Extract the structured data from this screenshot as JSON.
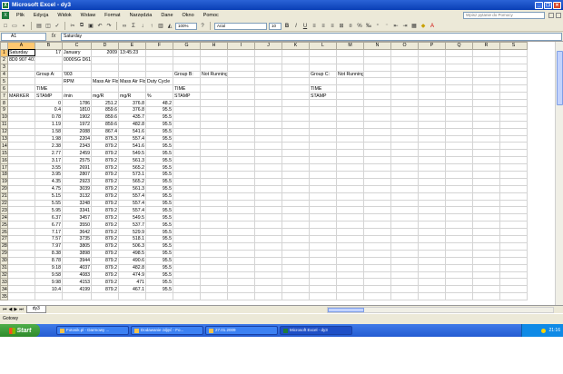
{
  "window": {
    "title": "Microsoft Excel - dy3"
  },
  "menu": {
    "items": [
      "Plik",
      "Edycja",
      "Widok",
      "Wstaw",
      "Format",
      "Narzędzia",
      "Dane",
      "Okno",
      "Pomoc"
    ],
    "help_placeholder": "Wpisz pytanie do Pomocy"
  },
  "toolbar": {
    "zoom": "100%",
    "font": "Arial",
    "size": "10"
  },
  "formula_bar": {
    "name_box": "A1",
    "fx": "fx",
    "value": "Saturday"
  },
  "columns": [
    "A",
    "B",
    "C",
    "D",
    "E",
    "F",
    "G",
    "H",
    "I",
    "J",
    "K",
    "L",
    "M",
    "N",
    "O",
    "P",
    "Q",
    "R",
    "S"
  ],
  "rows": [
    [
      "Saturday",
      "17",
      "January",
      "2009",
      "13:45:23",
      "",
      "",
      "",
      "",
      "",
      "",
      "",
      "",
      "",
      "",
      "",
      "",
      "",
      ""
    ],
    [
      "8D0 907 401 F 2",
      "",
      "0000SG  D61",
      "",
      "",
      "",
      "",
      "",
      "",
      "",
      "",
      "",
      "",
      "",
      "",
      "",
      "",
      "",
      ""
    ],
    [
      "",
      "",
      "",
      "",
      "",
      "",
      "",
      "",
      "",
      "",
      "",
      "",
      "",
      "",
      "",
      "",
      "",
      "",
      ""
    ],
    [
      "",
      "Group A:",
      "'003",
      "",
      "",
      "",
      "Group B:",
      "Not Running",
      "",
      "",
      "",
      "Group C:",
      "Not Running",
      "",
      "",
      "",
      "",
      "",
      ""
    ],
    [
      "",
      "",
      "RPM",
      "Mass Air Flow",
      "Mass Air Flow",
      "Duty Cycle",
      "",
      "",
      "",
      "",
      "",
      "",
      "",
      "",
      "",
      "",
      "",
      "",
      ""
    ],
    [
      "",
      "TIME",
      "",
      "",
      "",
      "",
      "TIME",
      "",
      "",
      "",
      "",
      "TIME",
      "",
      "",
      "",
      "",
      "",
      "",
      ""
    ],
    [
      "MARKER",
      "STAMP",
      "/min",
      "mg/R",
      "mg/R",
      "%",
      "STAMP",
      "",
      "",
      "",
      "",
      "STAMP",
      "",
      "",
      "",
      "",
      "",
      "",
      ""
    ],
    [
      "",
      "0",
      "1786",
      "251.2",
      "376.8",
      "48.2"
    ],
    [
      "",
      "0.4",
      "1810",
      "859.6",
      "376.8",
      "95.5"
    ],
    [
      "",
      "0.78",
      "1902",
      "859.6",
      "435.7",
      "95.5"
    ],
    [
      "",
      "1.19",
      "1972",
      "859.6",
      "482.8",
      "95.5"
    ],
    [
      "",
      "1.58",
      "2088",
      "867.4",
      "541.6",
      "95.5"
    ],
    [
      "",
      "1.98",
      "2204",
      "875.3",
      "557.4",
      "95.5"
    ],
    [
      "",
      "2.38",
      "2343",
      "879.2",
      "541.6",
      "95.5"
    ],
    [
      "",
      "2.77",
      "2459",
      "879.2",
      "549.5",
      "95.5"
    ],
    [
      "",
      "3.17",
      "2575",
      "879.2",
      "561.3",
      "95.5"
    ],
    [
      "",
      "3.55",
      "2691",
      "879.2",
      "565.2",
      "95.5"
    ],
    [
      "",
      "3.95",
      "2807",
      "879.2",
      "573.1",
      "95.5"
    ],
    [
      "",
      "4.35",
      "2923",
      "879.2",
      "565.2",
      "95.5"
    ],
    [
      "",
      "4.75",
      "3039",
      "879.2",
      "561.3",
      "95.5"
    ],
    [
      "",
      "5.15",
      "3132",
      "879.2",
      "557.4",
      "95.5"
    ],
    [
      "",
      "5.55",
      "3248",
      "879.2",
      "557.4",
      "95.5"
    ],
    [
      "",
      "5.95",
      "3341",
      "879.2",
      "557.4",
      "95.5"
    ],
    [
      "",
      "6.37",
      "3457",
      "879.2",
      "549.5",
      "95.5"
    ],
    [
      "",
      "6.77",
      "3550",
      "879.2",
      "537.7",
      "95.5"
    ],
    [
      "",
      "7.17",
      "3642",
      "879.2",
      "529.9",
      "95.5"
    ],
    [
      "",
      "7.57",
      "3735",
      "879.2",
      "518.1",
      "95.5"
    ],
    [
      "",
      "7.97",
      "3805",
      "879.2",
      "506.3",
      "95.5"
    ],
    [
      "",
      "8.38",
      "3898",
      "879.2",
      "498.5",
      "95.5"
    ],
    [
      "",
      "8.78",
      "3944",
      "879.2",
      "490.6",
      "95.5"
    ],
    [
      "",
      "9.18",
      "4037",
      "879.2",
      "482.8",
      "95.5"
    ],
    [
      "",
      "9.58",
      "4083",
      "879.2",
      "474.9",
      "95.5"
    ],
    [
      "",
      "9.98",
      "4153",
      "879.2",
      "471",
      "95.5"
    ],
    [
      "",
      "10.4",
      "4199",
      "879.2",
      "467.1",
      "95.5"
    ],
    [
      "",
      "",
      "",
      "",
      "",
      "",
      "",
      "",
      "",
      "",
      "",
      "",
      "",
      "",
      "",
      "",
      "",
      "",
      ""
    ]
  ],
  "sheet_tabs": [
    "dy3"
  ],
  "status": "Gotowy",
  "taskbar": {
    "start": "Start",
    "items": [
      "Fotosik.pl - Darmowy ...",
      "Dodawanie zdjęć - Fo...",
      "27.01.2009",
      "Microsoft Excel - dy3"
    ],
    "active_index": 3,
    "clock": "21:16"
  }
}
